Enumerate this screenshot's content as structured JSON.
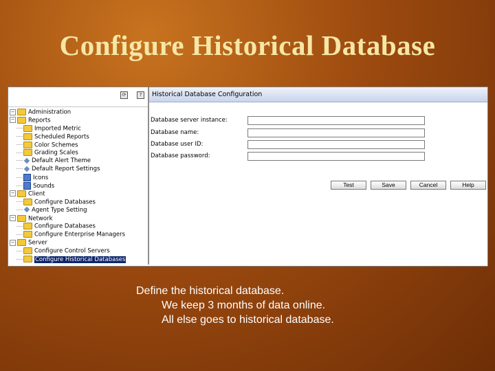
{
  "slide": {
    "title": "Configure Historical Database",
    "caption": {
      "main": "Define the historical database.",
      "sub1": "We keep 3 months of data online.",
      "sub2": "All else goes to historical database."
    }
  },
  "tree": {
    "items": [
      {
        "label": "Administration",
        "indent": 0,
        "icon": "folder-icon"
      },
      {
        "label": "Reports",
        "indent": 0,
        "icon": "folder-icon"
      },
      {
        "label": "Imported Metric",
        "indent": 1,
        "icon": "folder-icon"
      },
      {
        "label": "Scheduled Reports",
        "indent": 1,
        "icon": "folder-icon"
      },
      {
        "label": "Color Schemes",
        "indent": 1,
        "icon": "folder-icon"
      },
      {
        "label": "Grading Scales",
        "indent": 1,
        "icon": "folder-icon"
      },
      {
        "label": "Default Alert Theme",
        "indent": 1,
        "icon": "diamond-icon"
      },
      {
        "label": "Default Report Settings",
        "indent": 1,
        "icon": "diamond-icon"
      },
      {
        "label": "Icons",
        "indent": 1,
        "icon": "box-icon"
      },
      {
        "label": "Sounds",
        "indent": 1,
        "icon": "box-icon"
      },
      {
        "label": "Client",
        "indent": 0,
        "icon": "folder-icon"
      },
      {
        "label": "Configure Databases",
        "indent": 1,
        "icon": "folder-icon"
      },
      {
        "label": "Agent Type Setting",
        "indent": 1,
        "icon": "diamond-icon"
      },
      {
        "label": "Network",
        "indent": 0,
        "icon": "folder-icon"
      },
      {
        "label": "Configure Databases",
        "indent": 1,
        "icon": "folder-icon"
      },
      {
        "label": "Configure Enterprise Managers",
        "indent": 1,
        "icon": "folder-icon"
      },
      {
        "label": "Server",
        "indent": 0,
        "icon": "folder-icon"
      },
      {
        "label": "Configure Control Servers",
        "indent": 1,
        "icon": "folder-icon"
      },
      {
        "label": "Configure Historical Databases",
        "indent": 1,
        "icon": "folder-icon",
        "selected": true
      }
    ]
  },
  "form": {
    "title": "Historical Database Configuration",
    "fields": {
      "server_instance": {
        "label": "Database server instance:",
        "value": ""
      },
      "name": {
        "label": "Database name:",
        "value": ""
      },
      "user_id": {
        "label": "Database user ID:",
        "value": ""
      },
      "password": {
        "label": "Database password:",
        "value": ""
      }
    },
    "buttons": {
      "test": "Test",
      "save": "Save",
      "cancel": "Cancel",
      "help": "Help"
    }
  }
}
